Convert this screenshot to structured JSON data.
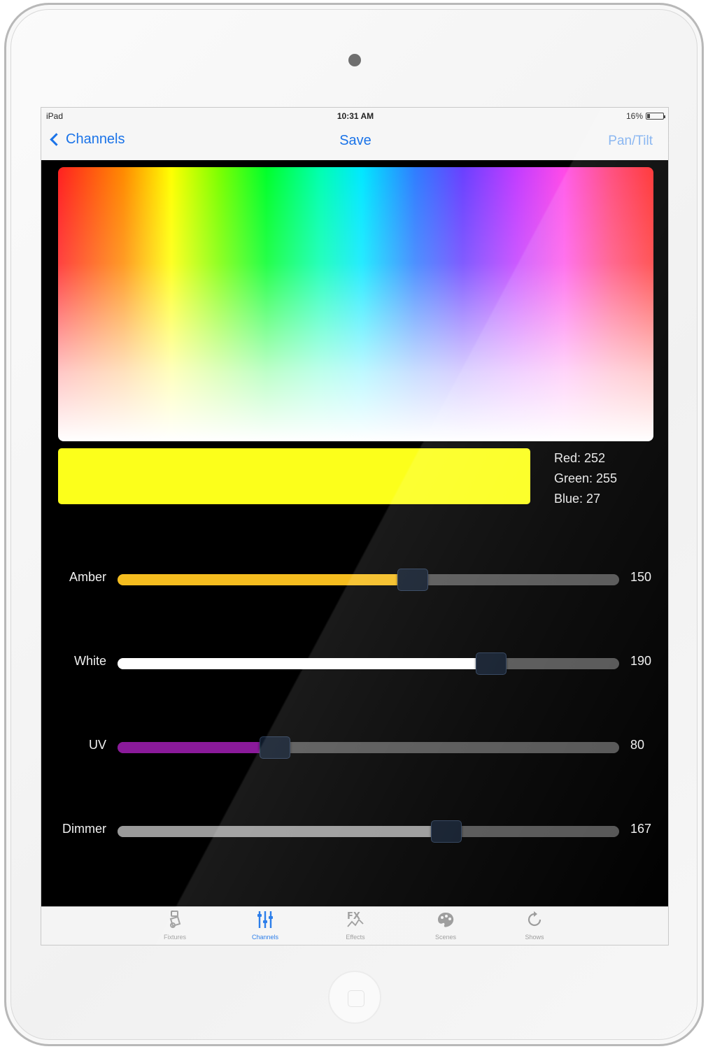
{
  "status_bar": {
    "device": "iPad",
    "time": "10:31 AM",
    "battery": "16%"
  },
  "nav": {
    "back_label": "Channels",
    "center_label": "Save",
    "right_label": "Pan/Tilt"
  },
  "swatch": {
    "color": "#fcff1b"
  },
  "rgb": {
    "red": "Red: 252",
    "green": "Green: 255",
    "blue": "Blue: 27"
  },
  "sliders": [
    {
      "label": "Amber",
      "value": "150",
      "level": 0.588,
      "fill_color": "#f5bd1f"
    },
    {
      "label": "White",
      "value": "190",
      "level": 0.745,
      "fill_color": "#ffffff"
    },
    {
      "label": "UV",
      "value": "80",
      "level": 0.314,
      "fill_color": "#8a1a9a"
    },
    {
      "label": "Dimmer",
      "value": "167",
      "level": 0.655,
      "fill_color": "#9a9a9a"
    }
  ],
  "tabs": [
    {
      "label": "Fixtures",
      "icon": "fixture-icon",
      "active": false
    },
    {
      "label": "Channels",
      "icon": "channels-icon",
      "active": true
    },
    {
      "label": "Effects",
      "icon": "fx-icon",
      "active": false
    },
    {
      "label": "Scenes",
      "icon": "palette-icon",
      "active": false
    },
    {
      "label": "Shows",
      "icon": "refresh-icon",
      "active": false
    }
  ]
}
